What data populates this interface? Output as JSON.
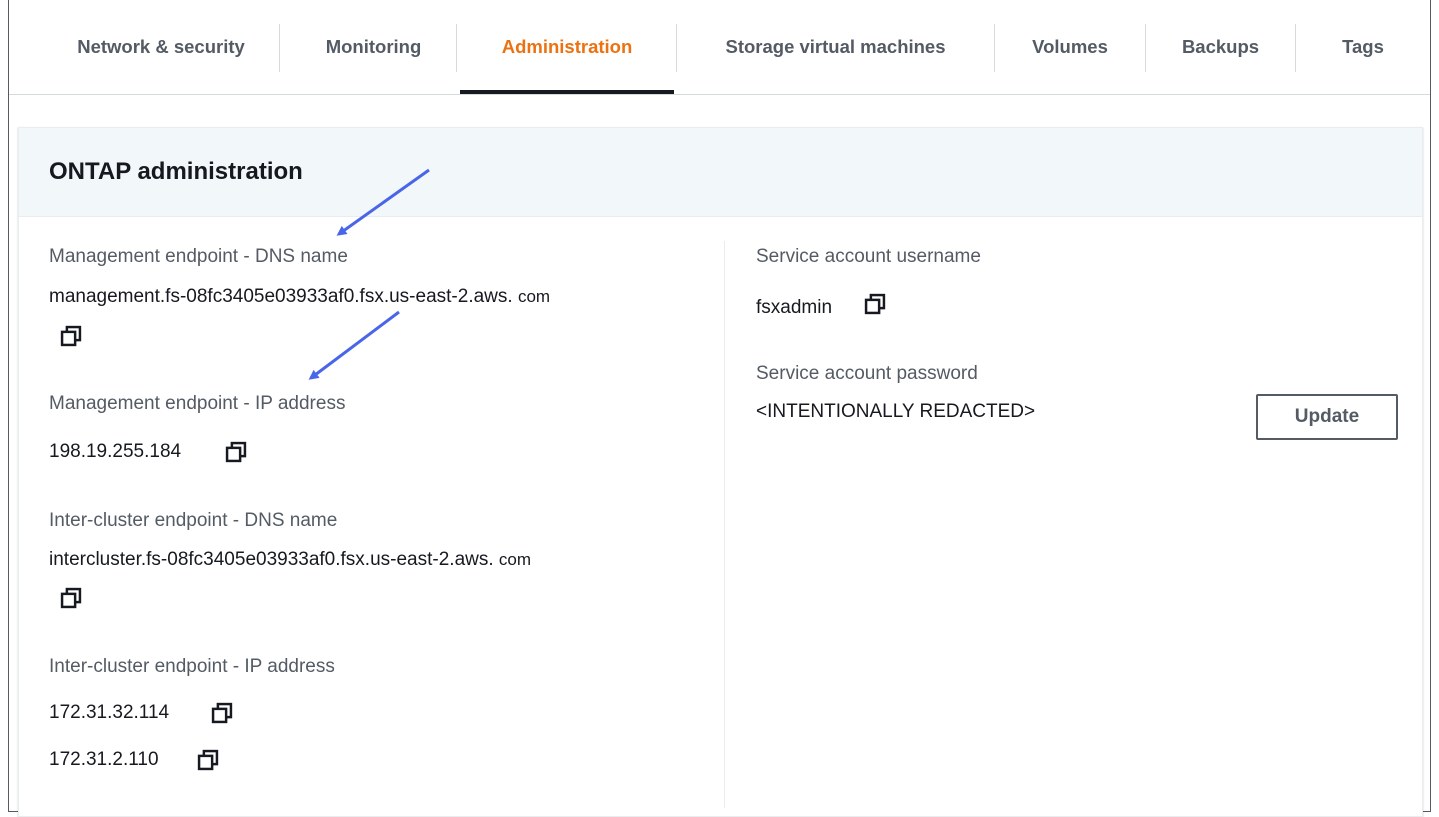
{
  "tabs": [
    {
      "label": "Network & security",
      "active": false
    },
    {
      "label": "Monitoring",
      "active": false
    },
    {
      "label": "Administration",
      "active": true
    },
    {
      "label": "Storage virtual machines",
      "active": false
    },
    {
      "label": "Volumes",
      "active": false
    },
    {
      "label": "Backups",
      "active": false
    },
    {
      "label": "Tags",
      "active": false
    }
  ],
  "panel": {
    "title": "ONTAP administration",
    "left": {
      "mgmt_dns_label": "Management endpoint - DNS name",
      "mgmt_dns_value": "management.fs-08fc3405e03933af0.fsx.us-east-2.aws.",
      "mgmt_dns_suffix": "com",
      "mgmt_ip_label": "Management endpoint - IP address",
      "mgmt_ip_value": "198.19.255.184",
      "ic_dns_label": "Inter-cluster endpoint - DNS name",
      "ic_dns_value": "intercluster.fs-08fc3405e03933af0.fsx.us-east-2.aws.",
      "ic_dns_suffix": "com",
      "ic_ip_label": "Inter-cluster endpoint - IP address",
      "ic_ip_values": [
        "172.31.32.114",
        "172.31.2.110"
      ]
    },
    "right": {
      "username_label": "Service account username",
      "username_value": "fsxadmin",
      "password_label": "Service account password",
      "password_value": "<INTENTIONALLY REDACTED>",
      "update_button": "Update"
    }
  },
  "colors": {
    "active_tab": "#ec7211",
    "annotation_arrow": "#4a66e8",
    "header_bg": "#f2f8fa"
  },
  "icons": {
    "copy": "copy-icon",
    "arrow": "annotation-arrow"
  }
}
